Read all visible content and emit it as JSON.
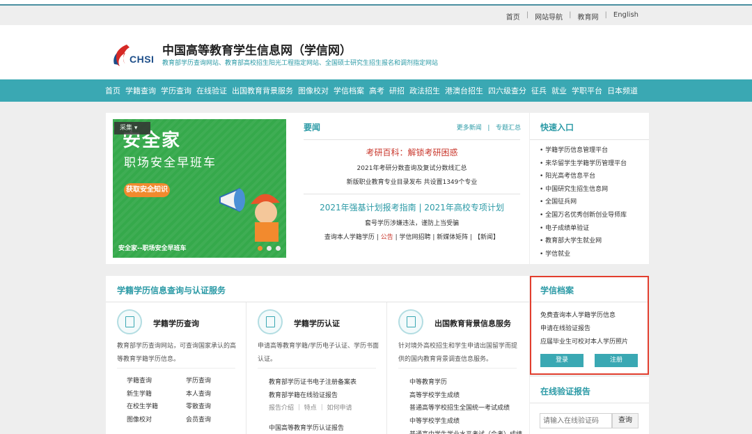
{
  "util_nav": [
    "首页",
    "网站导航",
    "教育网",
    "English"
  ],
  "header": {
    "logo_text": "CHSI",
    "title": "中国高等教育学生信息网（学信网）",
    "subtitle": "教育部学历查询网站、教育部高校招生阳光工程指定网站、全国硕士研究生招生报名和调剂指定网站"
  },
  "main_nav": [
    "首页",
    "学籍查询",
    "学历查询",
    "在线验证",
    "出国教育背景服务",
    "图像校对",
    "学信档案",
    "高考",
    "研招",
    "政法招生",
    "港澳台招生",
    "四六级查分",
    "征兵",
    "就业",
    "学职平台",
    "日本频道"
  ],
  "banner": {
    "collect": "采集",
    "big": "安全家",
    "sub": "职场安全早班车",
    "pill": "获取安全知识",
    "caption": "安全家--职场安全早班车"
  },
  "news": {
    "heading": "要闻",
    "more": "更多新闻",
    "topics": "专题汇总",
    "headline1": "考研百科：解锁考研困惑",
    "line2": "2021年考研分数查询及复试分数线汇总",
    "line3": "新版职业教育专业目录发布 共设置1349个专业",
    "headline2": "2021年强基计划报考指南 | 2021年高校专项计划",
    "line5": "套号学历涉嫌违法，谨防上当受骗",
    "line6a": "查询本人学籍学历",
    "line6b": "公告",
    "line6c": "学信网招聘",
    "line6d": "新媒体矩阵",
    "line6e": "【新闻】"
  },
  "quick": {
    "heading": "快速入口",
    "items": [
      "学籍学历信息管理平台",
      "来华留学生学籍学历管理平台",
      "阳光高考信息平台",
      "中国研究生招生信息网",
      "全国征兵网",
      "全国万名优秀创新创业导师库",
      "电子成绩单验证",
      "教育部大学生就业网",
      "学信就业"
    ]
  },
  "services": {
    "heading": "学籍学历信息查询与认证服务",
    "col1": {
      "title": "学籍学历查询",
      "desc": "教育部学历查询网站，可查询国家承认的高等教育学籍学历信息。",
      "links": [
        "学籍查询",
        "学历查询",
        "新生学籍",
        "本人查询",
        "在校生学籍",
        "零散查询",
        "图像校对",
        "会员查询"
      ]
    },
    "col2": {
      "title": "学籍学历认证",
      "desc": "申请高等教育学籍/学历电子认证、学历书面认证。",
      "items": [
        "教育部学历证书电子注册备案表",
        "教育部学籍在线验证报告",
        "报告介绍 ｜ 特点 ｜ 如何申请",
        "中国高等教育学历认证报告"
      ]
    },
    "col3": {
      "title": "出国教育背景信息服务",
      "desc": "针对境外高校招生和学生申请出国留学而提供的国内教育背景调查信息服务。",
      "items": [
        "中等教育学历",
        "高等学校学生成绩",
        "普通高等学校招生全国统一考试成绩",
        "中等学校学生成绩",
        "普通高中学生学业水平考试（会考）成绩"
      ]
    }
  },
  "archive": {
    "heading": "学信档案",
    "items": [
      "免费查询本人学籍学历信息",
      "申请在线验证报告",
      "应届毕业生可校对本人学历照片"
    ],
    "login": "登录",
    "register": "注册"
  },
  "verify": {
    "heading": "在线验证报告",
    "placeholder": "请输入在线验证码",
    "button": "查询"
  },
  "colors": {
    "accent": "#3aa8b3",
    "headline_red": "#c9372c",
    "highlight_border": "#e23e2e"
  }
}
